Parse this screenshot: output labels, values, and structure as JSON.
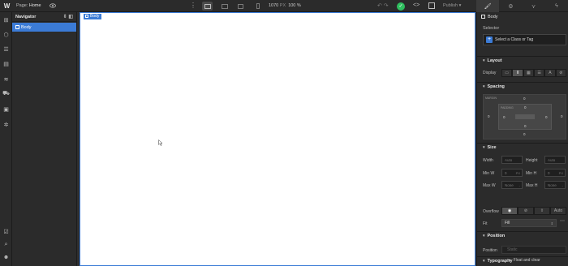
{
  "topbar": {
    "logo": "W",
    "page_prefix": "Page:",
    "page_name": "Home",
    "canvas_width": "1070",
    "width_unit": "PX",
    "zoom": "100 %",
    "publish_label": "Publish"
  },
  "navigator": {
    "title": "Navigator",
    "items": [
      {
        "label": "Body"
      }
    ]
  },
  "canvas": {
    "selected_tag": "Body"
  },
  "panel": {
    "selected_element": "Body",
    "selector": {
      "label": "Selector",
      "placeholder": "Select a Class or Tag"
    },
    "layout": {
      "title": "Layout",
      "display_label": "Display"
    },
    "spacing": {
      "title": "Spacing",
      "margin_label": "MARGIN",
      "padding_label": "PADDING",
      "margin": {
        "top": "0",
        "right": "0",
        "bottom": "0",
        "left": "0"
      },
      "padding": {
        "top": "0",
        "right": "0",
        "bottom": "0",
        "left": "0"
      }
    },
    "size": {
      "title": "Size",
      "width_label": "Width",
      "width_value": "Auto",
      "height_label": "Height",
      "height_value": "Auto",
      "min_w_label": "Min W",
      "min_w_value": "0",
      "min_w_unit": "PX",
      "min_h_label": "Min H",
      "min_h_value": "0",
      "min_h_unit": "PX",
      "max_w_label": "Max W",
      "max_w_value": "None",
      "max_h_label": "Max H",
      "max_h_value": "None",
      "overflow_label": "Overflow",
      "overflow_auto": "Auto",
      "fit_label": "Fit",
      "fit_value": "Fill"
    },
    "position": {
      "title": "Position",
      "position_label": "Position",
      "position_value": "Static",
      "float_label": "Float and clear"
    },
    "typography": {
      "title": "Typography"
    }
  },
  "colors": {
    "accent": "#3b7bd6",
    "success": "#2fbf5f",
    "ui_bg": "#2b2b2b",
    "canvas_bg": "#ffffff"
  }
}
